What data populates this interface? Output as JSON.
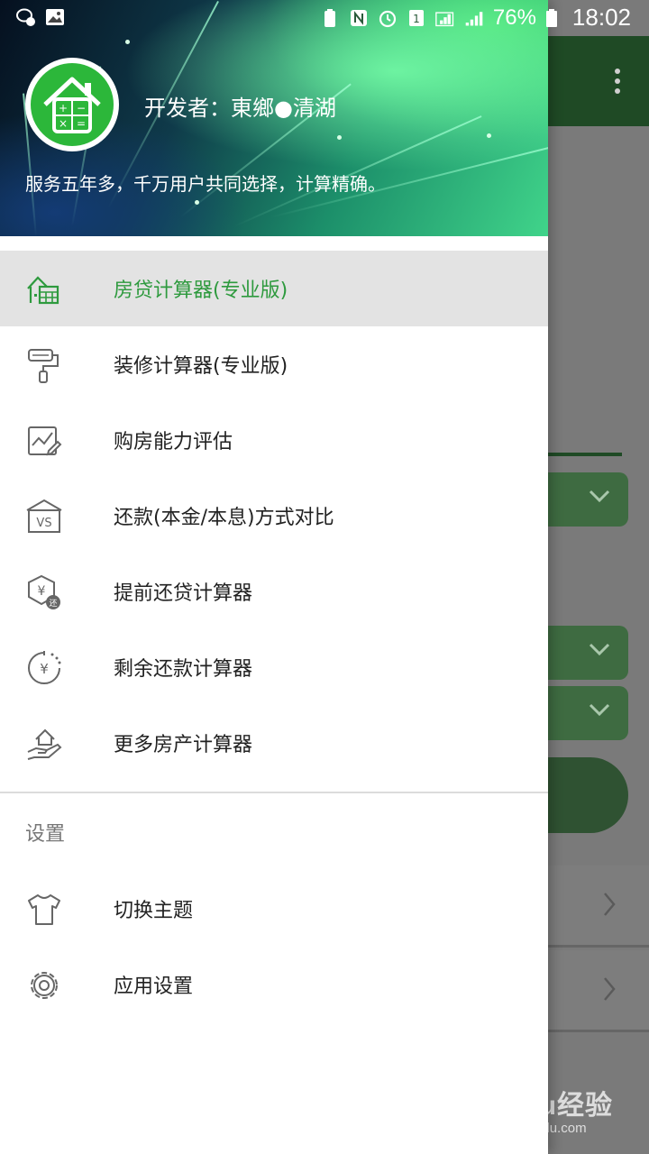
{
  "status_bar": {
    "battery_percent": "76%",
    "time": "18:02",
    "network": "4G",
    "icons": [
      "wechat-icon",
      "image-icon",
      "battery-saver-icon",
      "nfc-icon",
      "alarm-icon",
      "sim1-icon",
      "signal-e-icon",
      "signal-4g-icon",
      "battery-icon"
    ]
  },
  "drawer": {
    "header": {
      "developer_label": "开发者：東鄉●清湖",
      "description": "服务五年多，千万用户共同选择，计算精确。"
    },
    "menu_items": [
      {
        "label": "房贷计算器(专业版)",
        "icon": "house-calculator-icon",
        "active": true
      },
      {
        "label": "装修计算器(专业版)",
        "icon": "paint-roller-icon",
        "active": false
      },
      {
        "label": "购房能力评估",
        "icon": "chart-edit-icon",
        "active": false
      },
      {
        "label": "还款(本金/本息)方式对比",
        "icon": "vs-house-icon",
        "active": false
      },
      {
        "label": "提前还贷计算器",
        "icon": "yuan-repay-icon",
        "active": false
      },
      {
        "label": "剩余还款计算器",
        "icon": "yuan-timer-icon",
        "active": false
      },
      {
        "label": "更多房产计算器",
        "icon": "hand-house-icon",
        "active": false
      }
    ],
    "settings_title": "设置",
    "settings_items": [
      {
        "label": "切换主题",
        "icon": "tshirt-icon"
      },
      {
        "label": "应用设置",
        "icon": "gear-icon"
      }
    ]
  },
  "watermark": {
    "logo": "Baidu经验",
    "url": "jingyan.baidu.com"
  },
  "colors": {
    "accent": "#2e9a3e",
    "toolbar": "#1f4a25",
    "active_bg": "#e3e3e3"
  }
}
